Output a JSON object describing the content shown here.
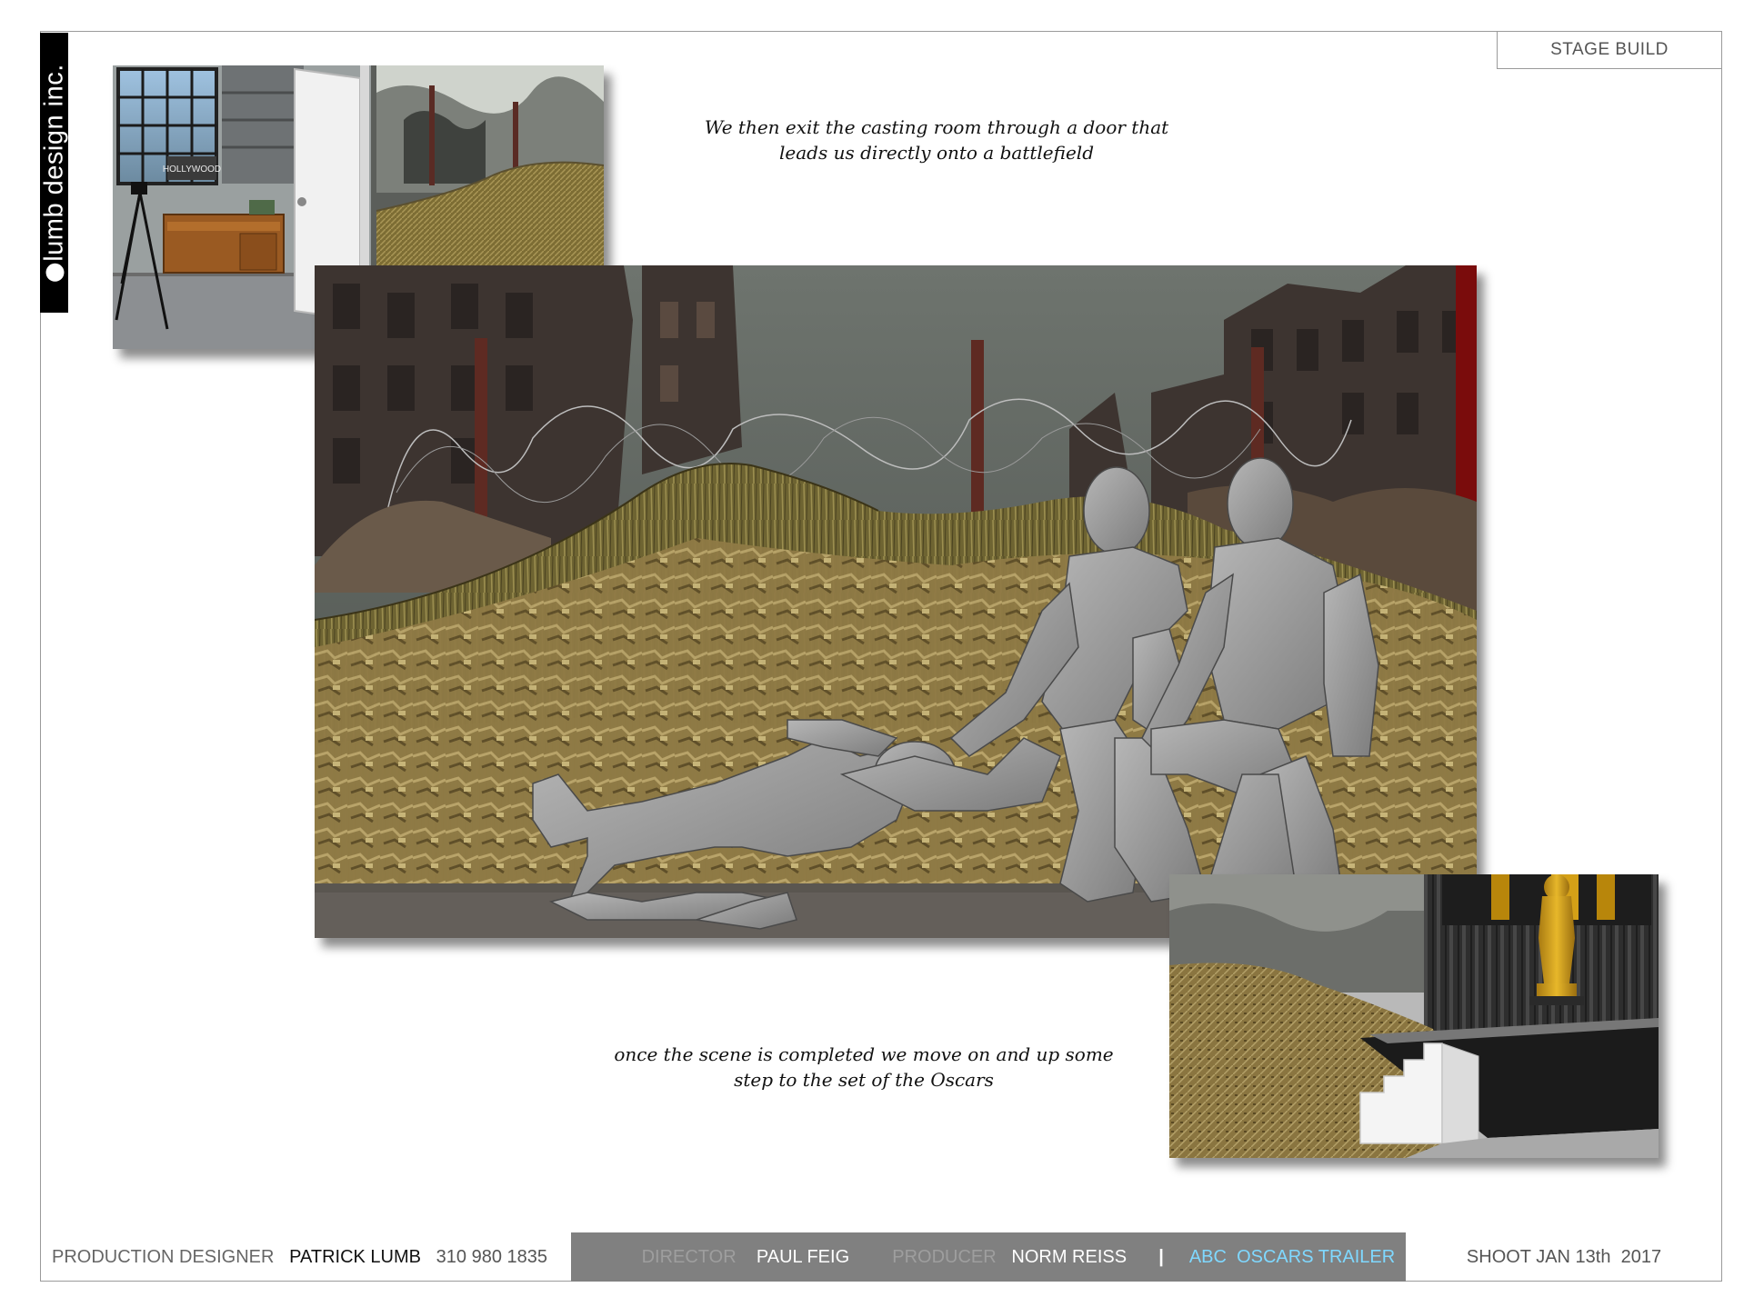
{
  "logo": {
    "text": "lumb design inc."
  },
  "header": {
    "stage_label": "STAGE BUILD"
  },
  "captions": {
    "top": [
      "We then exit the casting room through a door that",
      "leads us directly onto a battlefield"
    ],
    "bottom": [
      "once the scene is completed we move on and up some",
      "step to the set of the Oscars"
    ]
  },
  "images": {
    "casting_room": {
      "sign_text": "HOLLYWOOD"
    }
  },
  "footer": {
    "designer_label": "PRODUCTION DESIGNER",
    "designer_name": "PATRICK LUMB",
    "designer_phone": "310 980 1835",
    "director_label": "DIRECTOR",
    "director_name": "PAUL FEIG",
    "producer_label": "PRODUCER",
    "producer_name": "NORM REISS",
    "separator": "|",
    "project": "ABC  OSCARS TRAILER",
    "shoot": "SHOOT JAN 13th  2017"
  },
  "colors": {
    "footer_band": "#808080",
    "project_text": "#7fd8ff",
    "oscar_gold": "#d9a520"
  }
}
